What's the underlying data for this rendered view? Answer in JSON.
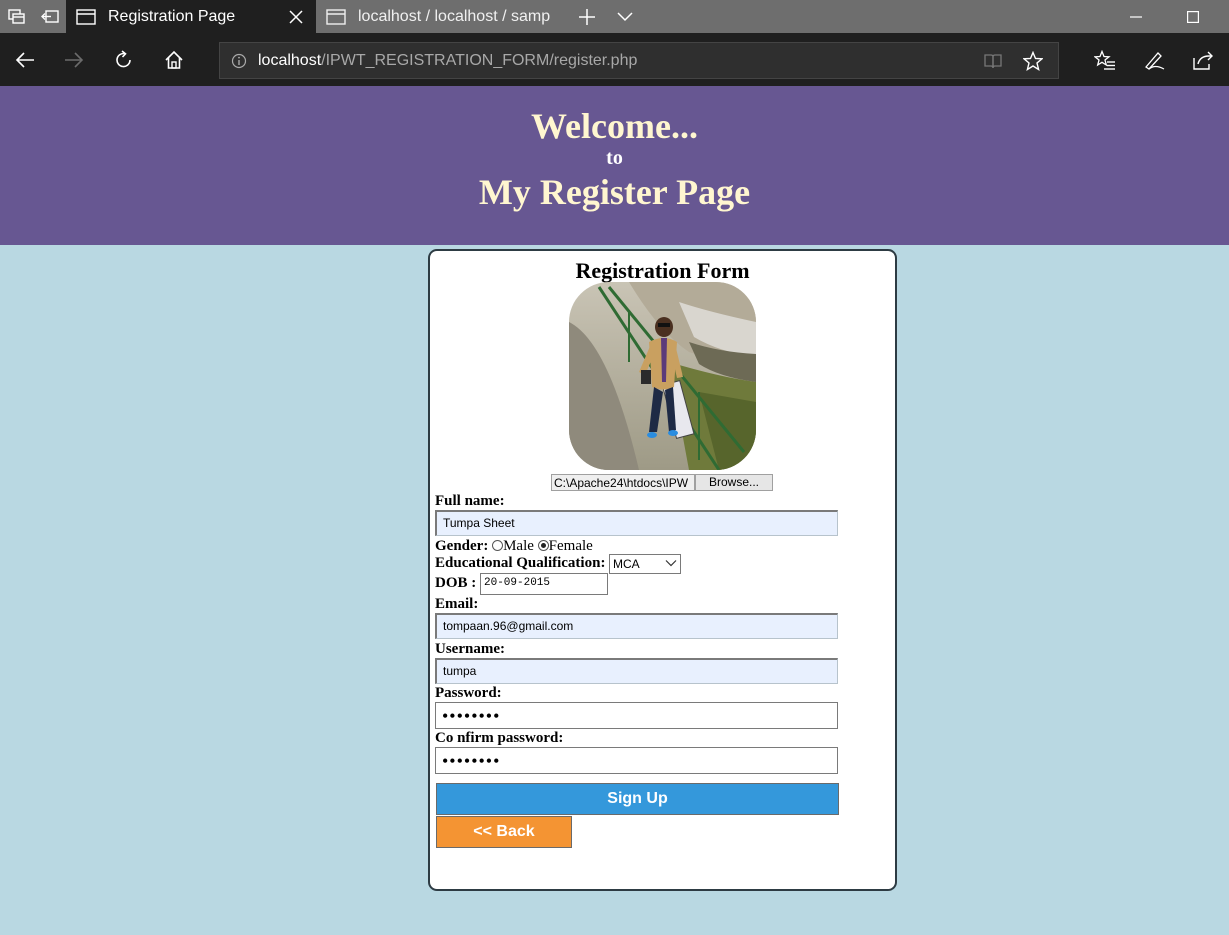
{
  "browser": {
    "tabs": [
      {
        "title": "Registration Page",
        "active": true
      },
      {
        "title": "localhost / localhost / samp",
        "active": false
      }
    ],
    "url": {
      "host": "localhost",
      "path": "/IPWT_REGISTRATION_FORM/register.php"
    }
  },
  "header": {
    "welcome": "Welcome...",
    "to": "to",
    "page_name": "My Register Page"
  },
  "form": {
    "title": "Registration Form",
    "file": {
      "path": "C:\\Apache24\\htdocs\\IPW",
      "browse_label": "Browse..."
    },
    "full_name": {
      "label": "Full name:",
      "value": "Tumpa Sheet"
    },
    "gender": {
      "label": "Gender:",
      "options": [
        "Male",
        "Female"
      ],
      "selected": "Female"
    },
    "qualification": {
      "label": "Educational Qualification:",
      "value": "MCA"
    },
    "dob": {
      "label": "DOB :",
      "value": "20-09-2015"
    },
    "email": {
      "label": "Email:",
      "value": "tompaan.96@gmail.com"
    },
    "username": {
      "label": "Username:",
      "value": "tumpa"
    },
    "password": {
      "label": "Password:",
      "value": "••••••••"
    },
    "confirm_password": {
      "label": "Co nfirm password:",
      "value": "••••••••"
    },
    "signup_label": "Sign Up",
    "back_label": "<< Back"
  },
  "colors": {
    "banner": "#675792",
    "page_bg": "#b9d8e2",
    "signup": "#3498db",
    "back": "#f49433"
  }
}
